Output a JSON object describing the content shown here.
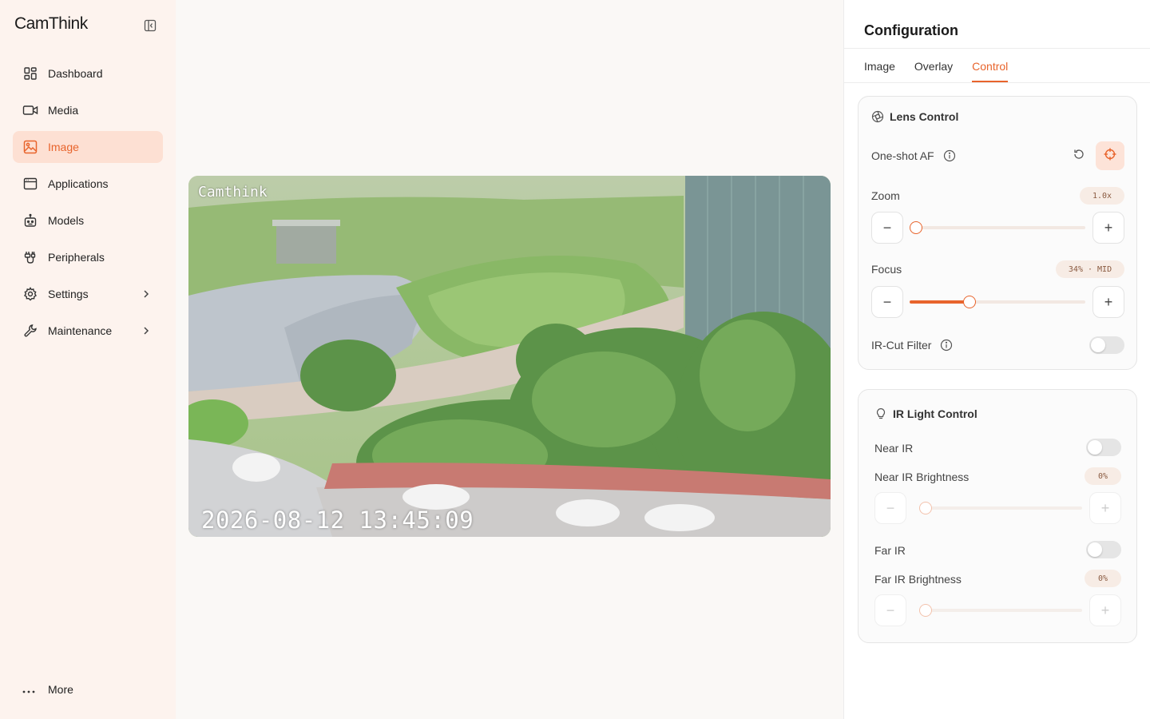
{
  "app": {
    "logo_text": "CamThink"
  },
  "sidebar": {
    "items": [
      {
        "label": "Dashboard",
        "icon": "dashboard-icon"
      },
      {
        "label": "Media",
        "icon": "video-camera-icon"
      },
      {
        "label": "Image",
        "icon": "image-icon",
        "active": true
      },
      {
        "label": "Applications",
        "icon": "browser-window-icon"
      },
      {
        "label": "Models",
        "icon": "robot-icon"
      },
      {
        "label": "Peripherals",
        "icon": "cable-icon"
      },
      {
        "label": "Settings",
        "icon": "gear-icon",
        "has_submenu": true
      },
      {
        "label": "Maintenance",
        "icon": "wrench-icon",
        "has_submenu": true
      }
    ],
    "more_label": "More"
  },
  "video": {
    "osd_name": "Camthink",
    "osd_timestamp": "2026-08-12 13:45:09"
  },
  "panel": {
    "title": "Configuration",
    "tabs": [
      {
        "label": "Image",
        "active": false
      },
      {
        "label": "Overlay",
        "active": false
      },
      {
        "label": "Control",
        "active": true
      }
    ],
    "lens": {
      "title": "Lens Control",
      "af_label": "One-shot AF",
      "zoom": {
        "label": "Zoom",
        "value_text": "1.0x",
        "fraction": 0.0
      },
      "focus": {
        "label": "Focus",
        "value_text": "34% · MID",
        "fraction": 0.34
      },
      "ircut": {
        "label": "IR-Cut Filter",
        "on": false
      }
    },
    "ir": {
      "title": "IR Light Control",
      "near": {
        "label": "Near IR",
        "on": false
      },
      "near_brightness": {
        "label": "Near IR Brightness",
        "value_text": "0%",
        "fraction": 0.0
      },
      "far": {
        "label": "Far IR",
        "on": false
      },
      "far_brightness": {
        "label": "Far IR Brightness",
        "value_text": "0%",
        "fraction": 0.0
      }
    }
  },
  "colors": {
    "accent": "#e8642c",
    "accent_soft": "#fde0d3",
    "sidebar_bg": "#fdf3ee"
  }
}
